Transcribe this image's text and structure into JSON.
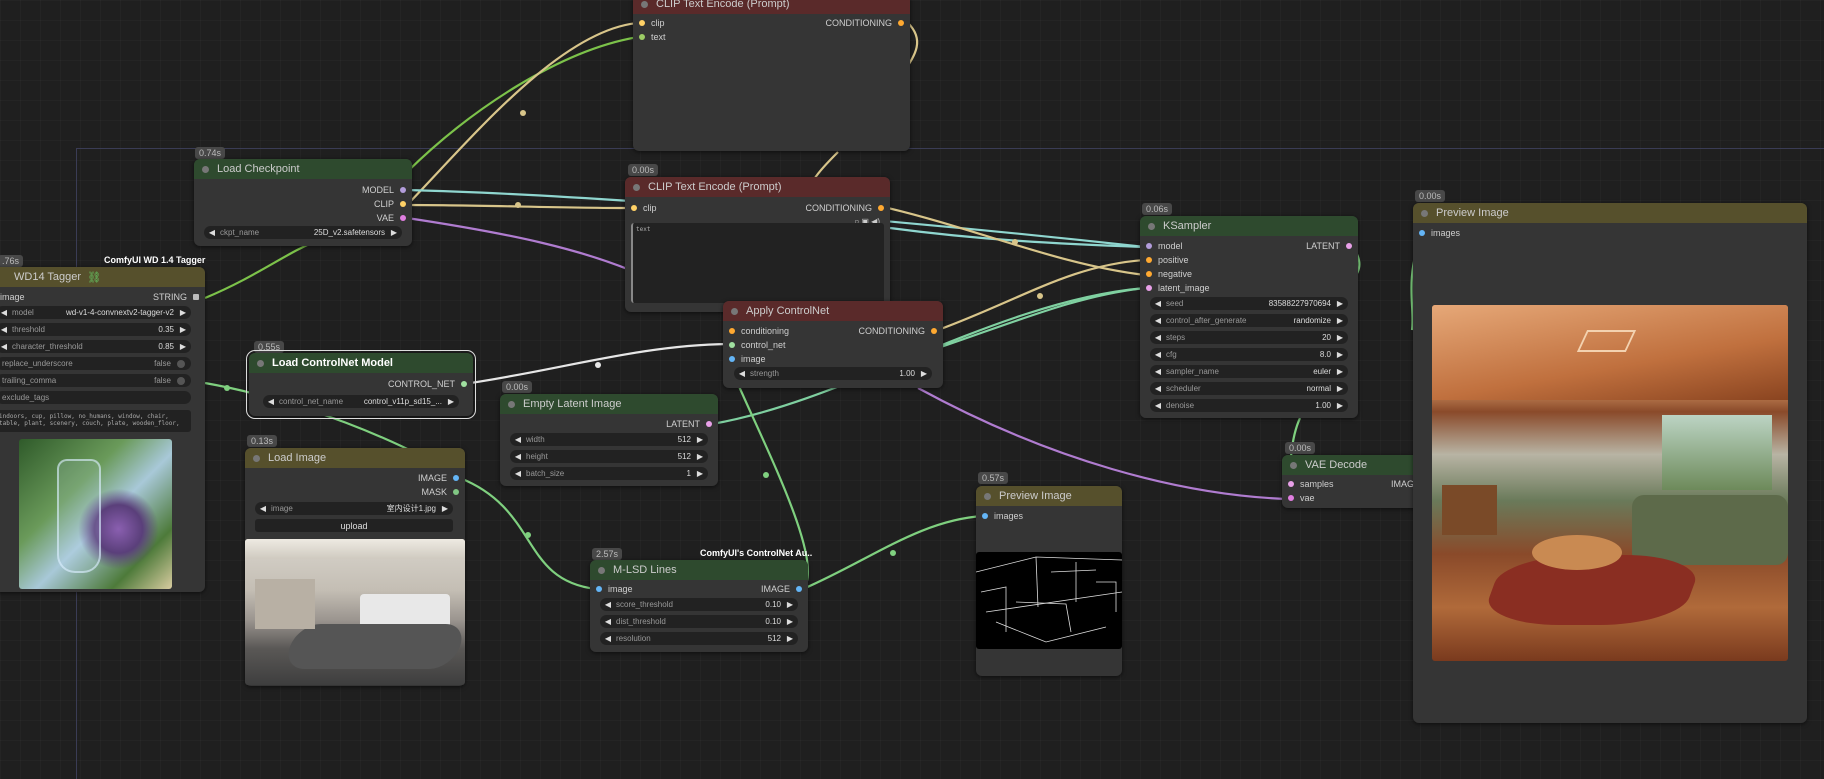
{
  "colors": {
    "canvas": "#1f1f1f",
    "node_body": "#353535",
    "header_green": "#2e4a2e",
    "header_red": "#5a2a2a",
    "header_yellow": "#56502c",
    "link_green": "#7fd07f",
    "link_clip": "#d8c58a",
    "link_model": "#8fd6cf",
    "link_vae": "#b07cd0",
    "link_white": "#e6e6e6"
  },
  "nodes": {
    "clip_top": {
      "title": "CLIP Text Encode (Prompt)",
      "inputs": [
        "clip",
        "text"
      ],
      "output": "CONDITIONING"
    },
    "load_checkpoint": {
      "time": "0.74s",
      "title": "Load Checkpoint",
      "outputs": [
        "MODEL",
        "CLIP",
        "VAE"
      ],
      "ckpt_label": "ckpt_name",
      "ckpt_value": "25D_v2.safetensors"
    },
    "clip_mid": {
      "time": "0.00s",
      "title": "CLIP Text Encode (Prompt)",
      "input": "clip",
      "output": "CONDITIONING",
      "text_value": "text"
    },
    "wd14": {
      "time": ".76s",
      "tag": "ComfyUI WD 1.4 Tagger",
      "title": "WD14 Tagger",
      "input": "image",
      "output": "STRING",
      "model_label": "model",
      "model_value": "wd-v1-4-convnextv2-tagger-v2",
      "threshold_label": "threshold",
      "threshold_value": "0.35",
      "char_label": "character_threshold",
      "char_value": "0.85",
      "replace_label": "replace_underscore",
      "replace_value": "false",
      "trailing_label": "trailing_comma",
      "trailing_value": "false",
      "exclude_label": "exclude_tags",
      "tags_text": "indoors, cup, pillow, no_humans, window, chair, table, plant, scenery, couch, plate, wooden_floor,"
    },
    "load_cn": {
      "time": "0.55s",
      "title": "Load ControlNet Model",
      "output": "CONTROL_NET",
      "label": "control_net_name",
      "value": "control_v11p_sd15_..."
    },
    "apply_cn": {
      "title": "Apply ControlNet",
      "inputs": [
        "conditioning",
        "control_net",
        "image"
      ],
      "output": "CONDITIONING",
      "strength_label": "strength",
      "strength_value": "1.00"
    },
    "empty_latent": {
      "time": "0.00s",
      "title": "Empty Latent Image",
      "output": "LATENT",
      "width_label": "width",
      "width_value": "512",
      "height_label": "height",
      "height_value": "512",
      "batch_label": "batch_size",
      "batch_value": "1"
    },
    "load_image": {
      "time": "0.13s",
      "title": "Load Image",
      "outputs": [
        "IMAGE",
        "MASK"
      ],
      "image_label": "image",
      "image_value": "室内设计1.jpg",
      "upload_label": "upload"
    },
    "mlsd": {
      "time": "2.57s",
      "tag": "ComfyUI's ControlNet Au..",
      "title": "M-LSD Lines",
      "input": "image",
      "output": "IMAGE",
      "score_label": "score_threshold",
      "score_value": "0.10",
      "dist_label": "dist_threshold",
      "dist_value": "0.10",
      "res_label": "resolution",
      "res_value": "512"
    },
    "preview_mid": {
      "time": "0.57s",
      "title": "Preview Image",
      "input": "images"
    },
    "ksampler": {
      "time": "0.06s",
      "title": "KSampler",
      "inputs": [
        "model",
        "positive",
        "negative",
        "latent_image"
      ],
      "output": "LATENT",
      "widgets": [
        {
          "label": "seed",
          "value": "835882279706​94"
        },
        {
          "label": "control_after_generate",
          "value": "randomize"
        },
        {
          "label": "steps",
          "value": "20"
        },
        {
          "label": "cfg",
          "value": "8.0"
        },
        {
          "label": "sampler_name",
          "value": "euler"
        },
        {
          "label": "scheduler",
          "value": "normal"
        },
        {
          "label": "denoise",
          "value": "1.00"
        }
      ]
    },
    "vae_decode": {
      "time": "0.00s",
      "title": "VAE Decode",
      "inputs": [
        "samples",
        "vae"
      ],
      "output": "IMAGE"
    },
    "preview_right": {
      "time": "0.00s",
      "title": "Preview Image",
      "input": "images"
    }
  }
}
